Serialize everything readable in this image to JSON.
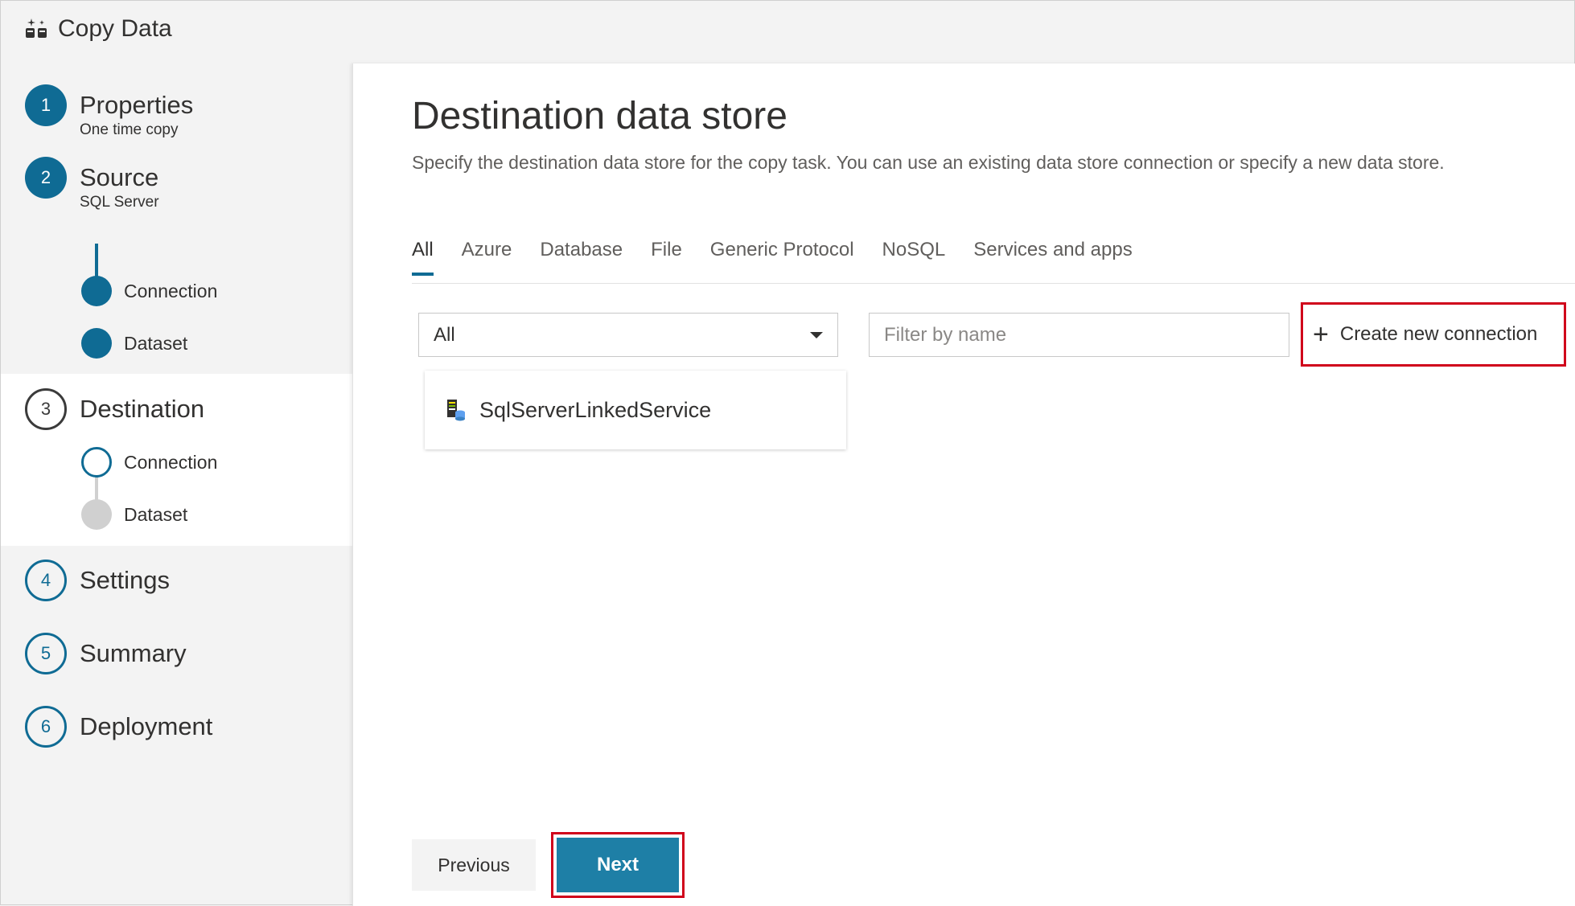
{
  "app": {
    "title": "Copy Data",
    "icon": "copy-data-icon"
  },
  "steps": [
    {
      "number": "1",
      "label": "Properties",
      "sub": "One time copy",
      "state": "done"
    },
    {
      "number": "2",
      "label": "Source",
      "sub": "SQL Server",
      "state": "done",
      "substeps": [
        {
          "label": "Connection",
          "state": "done"
        },
        {
          "label": "Dataset",
          "state": "done"
        }
      ]
    },
    {
      "number": "3",
      "label": "Destination",
      "state": "current",
      "substeps": [
        {
          "label": "Connection",
          "state": "current"
        },
        {
          "label": "Dataset",
          "state": "pending"
        }
      ]
    },
    {
      "number": "4",
      "label": "Settings",
      "state": "pending"
    },
    {
      "number": "5",
      "label": "Summary",
      "state": "pending"
    },
    {
      "number": "6",
      "label": "Deployment",
      "state": "pending"
    }
  ],
  "main": {
    "title": "Destination data store",
    "description": "Specify the destination data store for the copy task. You can use an existing data store connection or specify a new data store.",
    "tabs": [
      {
        "label": "All",
        "active": true
      },
      {
        "label": "Azure"
      },
      {
        "label": "Database"
      },
      {
        "label": "File"
      },
      {
        "label": "Generic Protocol"
      },
      {
        "label": "NoSQL"
      },
      {
        "label": "Services and apps"
      }
    ],
    "type_filter": {
      "value": "All"
    },
    "name_filter": {
      "placeholder": "Filter by name",
      "value": ""
    },
    "create_button": "Create new connection",
    "connections": [
      {
        "name": "SqlServerLinkedService",
        "icon": "sql-server-icon"
      }
    ]
  },
  "footer": {
    "previous": "Previous",
    "next": "Next"
  },
  "colors": {
    "accent": "#0f6b94",
    "primary_button": "#1e7fa6",
    "highlight_border": "#d0021b"
  }
}
